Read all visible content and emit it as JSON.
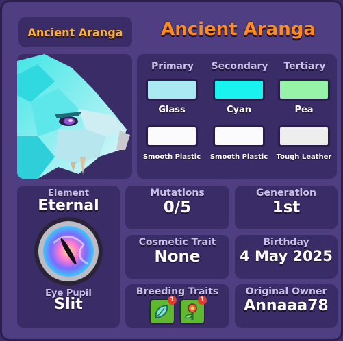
{
  "header": {
    "name_tag": "Ancient Aranga",
    "title": "Ancient Aranga"
  },
  "colors": {
    "columns": [
      "Primary",
      "Secondary",
      "Tertiary"
    ],
    "swatches": [
      {
        "color": "#a9eaf2",
        "label": "Glass"
      },
      {
        "color": "#19f2ee",
        "label": "Cyan"
      },
      {
        "color": "#96f3a8",
        "label": "Pea"
      },
      {
        "color": "#fbfbfd",
        "label": "Smooth Plastic"
      },
      {
        "color": "#fbfbfd",
        "label": "Smooth Plastic"
      },
      {
        "color": "#eeeeef",
        "label": "Tough Leather"
      }
    ]
  },
  "element": {
    "label": "Element",
    "value": "Eternal"
  },
  "eye_pupil": {
    "label": "Eye Pupil",
    "value": "Slit"
  },
  "mutations": {
    "label": "Mutations",
    "value": "0/5"
  },
  "generation": {
    "label": "Generation",
    "value": "1st"
  },
  "cosmetic_trait": {
    "label": "Cosmetic Trait",
    "value": "None"
  },
  "birthday": {
    "label": "Birthday",
    "value": "4 May 2025"
  },
  "breeding_traits": {
    "label": "Breeding Traits",
    "icons": [
      "leaf-trait-icon",
      "flower-trait-icon"
    ],
    "badges": [
      "1",
      "1"
    ]
  },
  "original_owner": {
    "label": "Original Owner",
    "value": "Annaaa78"
  },
  "theme": {
    "accent": "#ff8a1e",
    "panel": "#3a2c66",
    "frame": "#4f3f82"
  }
}
